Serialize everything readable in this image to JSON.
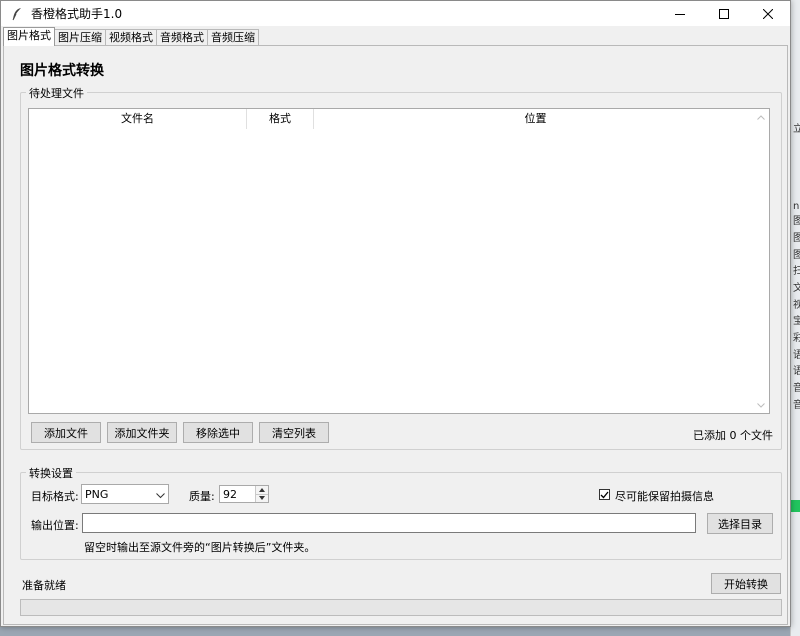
{
  "window": {
    "title": "香橙格式助手1.0"
  },
  "tabs": [
    {
      "label": "图片格式",
      "active": true
    },
    {
      "label": "图片压缩",
      "active": false
    },
    {
      "label": "视频格式",
      "active": false
    },
    {
      "label": "音频格式",
      "active": false
    },
    {
      "label": "音频压缩",
      "active": false
    }
  ],
  "page_title": "图片格式转换",
  "files_group": {
    "legend": "待处理文件",
    "columns": [
      "文件名",
      "格式",
      "位置"
    ],
    "rows": [],
    "buttons": {
      "add_file": "添加文件",
      "add_folder": "添加文件夹",
      "remove_selected": "移除选中",
      "clear_list": "清空列表"
    },
    "count_text": "已添加 0 个文件"
  },
  "settings_group": {
    "legend": "转换设置",
    "target_format_label": "目标格式:",
    "target_format_value": "PNG",
    "quality_label": "质量:",
    "quality_value": "92",
    "keep_exif_label": "尽可能保留拍摄信息",
    "keep_exif_checked": true,
    "output_label": "输出位置:",
    "output_value": "",
    "choose_dir_button": "选择目录",
    "output_hint": "留空时输出至源文件旁的“图片转换后”文件夹。"
  },
  "status": {
    "text": "准备就绪",
    "start_button": "开始转换",
    "progress": 0
  },
  "background_fragments": [
    "立",
    "n",
    "图",
    "图",
    "图",
    "扫",
    "文",
    "视",
    "宝",
    "彩",
    "语",
    "语",
    "音",
    "音"
  ],
  "colors": {
    "window_bg": "#f0f0f0",
    "titlebar_bg": "#ffffff",
    "accent_green": "#22c55e"
  }
}
